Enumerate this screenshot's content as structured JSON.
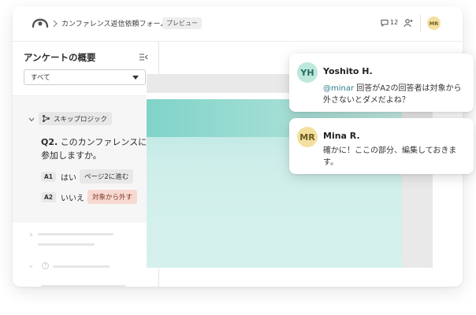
{
  "topbar": {
    "breadcrumb": "カンファレンス返信依頼フォーム",
    "preview_badge": "プレビュー",
    "comment_count": "12",
    "user_avatar": "MR",
    "icons": [
      "logo-icon",
      "chevron-right-icon",
      "comment-icon",
      "user-add-icon"
    ]
  },
  "sidebar": {
    "title": "アンケートの概要",
    "filter_value": "すべて",
    "logic_chip": "スキップロジック",
    "question_id": "Q2.",
    "question_text": "このカンファレンスに参加しますか。",
    "answers": [
      {
        "id": "A1",
        "text": "はい",
        "tag": "ページ2に進む",
        "tag_color": "#e8e8e8"
      },
      {
        "id": "A2",
        "text": "いいえ",
        "tag": "対象から外す",
        "tag_color": "#f8d9d1"
      }
    ]
  },
  "comments": [
    {
      "initials": "YH",
      "name": "Yoshito H.",
      "avatar_color": "#bde8dc",
      "mention": "@minar",
      "text": " 回答がA2の回答者は対象から外さないとダメだよね？"
    },
    {
      "initials": "MR",
      "name": "Mina R.",
      "avatar_color": "#f3e0a0",
      "text": "確かに！ここの部分、編集しておきます。"
    }
  ],
  "colors": {
    "teal_accent": "#7fd3c8",
    "mention": "#2f7f8c"
  }
}
